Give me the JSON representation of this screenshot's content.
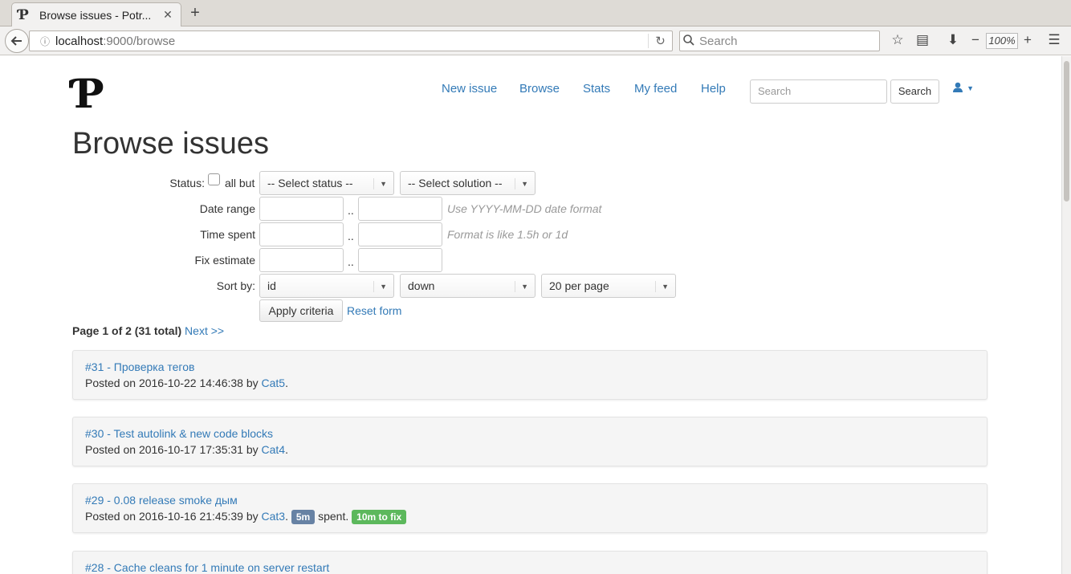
{
  "browser": {
    "tab_title": "Browse issues - Potr...",
    "tab_favicon": "Ƥ",
    "url_host": "localhost",
    "url_rest": ":9000/browse",
    "search_placeholder": "Search",
    "zoom": "100%"
  },
  "site": {
    "logo": "Ƥ",
    "nav": [
      "New issue",
      "Browse",
      "Stats",
      "My feed",
      "Help"
    ],
    "search_placeholder": "Search",
    "search_button": "Search"
  },
  "page_title": "Browse issues",
  "form": {
    "status_label": "Status:",
    "all_but_label": "all but",
    "status_select": "-- Select status --",
    "solution_select": "-- Select solution --",
    "date_range_label": "Date range",
    "date_hint": "Use YYYY-MM-DD date format",
    "time_spent_label": "Time spent",
    "time_hint": "Format is like 1.5h or 1d",
    "fix_estimate_label": "Fix estimate",
    "range_sep": "..",
    "sort_label": "Sort by:",
    "sort_field": "id",
    "sort_dir": "down",
    "per_page": "20 per page",
    "apply_button": "Apply criteria",
    "reset_link": "Reset form"
  },
  "pager": {
    "summary": "Page 1 of 2 (31 total)",
    "next": "Next >>"
  },
  "issues": [
    {
      "title": "#31 - Проверка тегов",
      "posted": "Posted on 2016-10-22 14:46:38 by ",
      "author": "Cat5"
    },
    {
      "title": "#30 - Test autolink & new code blocks",
      "posted": "Posted on 2016-10-17 17:35:31 by ",
      "author": "Cat4"
    },
    {
      "title": "#29 - 0.08 release smoke дым",
      "posted": "Posted on 2016-10-16 21:45:39 by ",
      "author": "Cat3",
      "spent_badge": "5m",
      "spent_text": "spent.",
      "fix_badge": "10m to fix"
    },
    {
      "title": "#28 - Cache cleans for 1 minute on server restart"
    }
  ]
}
